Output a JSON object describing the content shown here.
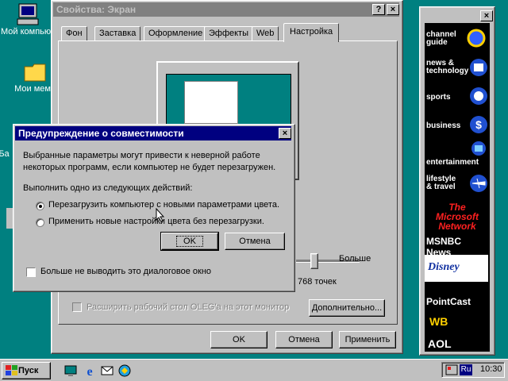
{
  "desktop": {
    "icons": [
      {
        "label": "Мой компьютер"
      },
      {
        "label": "Мои мемы"
      },
      {
        "label": "Ба"
      },
      {
        "label": ""
      }
    ]
  },
  "display_props": {
    "title": "Свойства: Экран",
    "tabs": [
      "Фон",
      "Заставка",
      "Оформление",
      "Эффекты",
      "Web",
      "Настройка"
    ],
    "active_tab": "Настройка",
    "slider_high_label": "Больше",
    "resolution_label": "768 точек",
    "extend_desktop_label": "Расширить рабочий стол OLEG'а на этот монитор",
    "advanced_button": "Дополнительно...",
    "ok_button": "OK",
    "cancel_button": "Отмена",
    "apply_button": "Применить"
  },
  "dialog": {
    "title": "Предупреждение о совместимости",
    "message_line1": "Выбранные параметры могут привести к неверной работе",
    "message_line2": "некоторых программ, если компьютер не будет перезагружен.",
    "action_prompt": "Выполнить одно из следующих действий:",
    "option_restart": "Перезагрузить компьютер с новыми параметрами цвета.",
    "option_apply": "Применить новые настройки цвета без перезагрузки.",
    "selected_option": "restart",
    "ok_button": "OK",
    "cancel_button": "Отмена",
    "dont_show_label": "Больше не выводить это диалоговое окно"
  },
  "channel_bar": {
    "items": [
      {
        "label": "channel guide"
      },
      {
        "label": "news & technology"
      },
      {
        "label": "sports"
      },
      {
        "label": "business"
      },
      {
        "label": "entertainment"
      },
      {
        "label": "lifestyle & travel"
      },
      {
        "label": "The Microsoft Network"
      },
      {
        "label": "MSNBC News"
      },
      {
        "label": "Disney"
      },
      {
        "label": "PointCast"
      },
      {
        "label": "WB"
      },
      {
        "label": "AOL"
      }
    ]
  },
  "taskbar": {
    "start_label": "Пуск",
    "lang": "Ru",
    "clock": "10:30"
  },
  "colors": {
    "desktop": "#008080",
    "active_title": "#000080",
    "inactive_title": "#808080",
    "face": "#c0c0c0"
  }
}
